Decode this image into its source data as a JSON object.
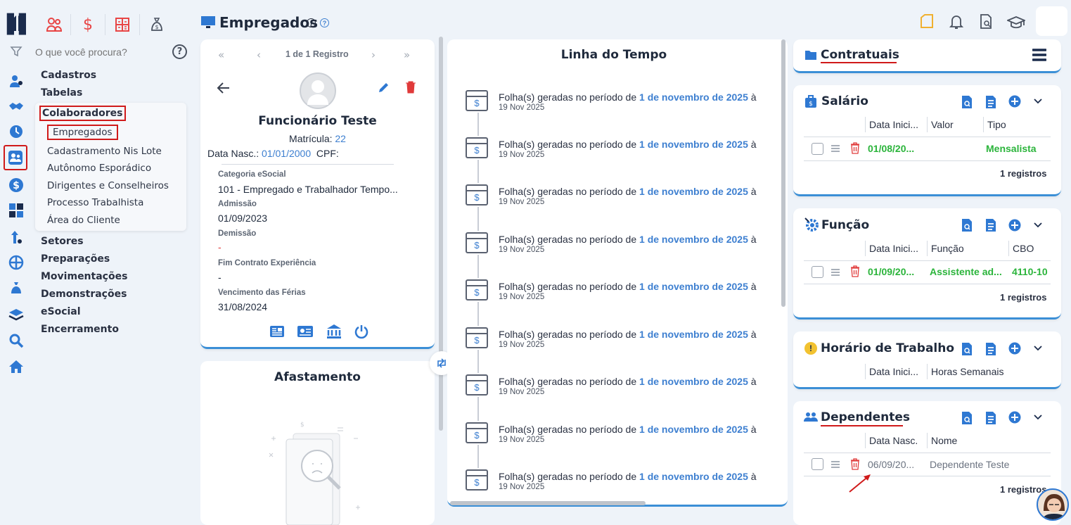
{
  "top_modules": [
    {
      "icon": "people-icon",
      "color": "#e84545"
    },
    {
      "icon": "dollar-icon",
      "color": "#e84545"
    },
    {
      "icon": "calculator-icon",
      "color": "#e84545"
    },
    {
      "icon": "money-bag-icon",
      "color": "#4a5260"
    }
  ],
  "search": {
    "placeholder": "O que você procura?"
  },
  "menu": {
    "cadastros": "Cadastros",
    "tabelas": "Tabelas",
    "colaboradores": "Colaboradores",
    "sub": [
      "Empregados",
      "Cadastramento Nis Lote",
      "Autônomo Esporádico",
      "Dirigentes e Conselheiros",
      "Processo Trabalhista",
      "Área do Cliente"
    ],
    "setores": "Setores",
    "preparacoes": "Preparações",
    "movimentacoes": "Movimentações",
    "demonstracoes": "Demonstrações",
    "esocial": "eSocial",
    "encerramento": "Encerramento"
  },
  "page": {
    "title": "Empregados"
  },
  "record": {
    "nav": "1 de 1 Registro",
    "name": "Funcionário Teste",
    "matricula_label": "Matrícula:",
    "matricula": "22",
    "nasc_label": "Data Nasc.:",
    "nasc": "01/01/2000",
    "cpf_label": "CPF:",
    "cat_label": "Categoria eSocial",
    "cat": "101 - Empregado e Trabalhador Tempo...",
    "adm_label": "Admissão",
    "adm": "01/09/2023",
    "dem_label": "Demissão",
    "dem": "-",
    "fim_label": "Fim Contrato Experiência",
    "fim": "-",
    "ferias_label": "Vencimento das Férias",
    "ferias": "31/08/2024"
  },
  "afastamento": {
    "title": "Afastamento"
  },
  "timeline": {
    "title": "Linha do Tempo",
    "prefix": "Folha(s) geradas no período de ",
    "period": "1 de novembro de 2025",
    "suffix": " à",
    "date": "19 Nov 2025"
  },
  "contratuais": {
    "title": "Contratuais"
  },
  "salario": {
    "title": "Salário",
    "cols": [
      "Data Inici...",
      "Valor",
      "Tipo"
    ],
    "row": [
      "01/08/20...",
      "",
      "Mensalista"
    ],
    "count": "1 registros"
  },
  "funcao": {
    "title": "Função",
    "cols": [
      "Data Inici...",
      "Função",
      "CBO"
    ],
    "row": [
      "01/09/20...",
      "Assistente ad...",
      "4110-10"
    ],
    "count": "1 registros"
  },
  "horario": {
    "title": "Horário de Trabalho",
    "cols": [
      "Data Inici...",
      "Horas Semanais"
    ]
  },
  "dependentes": {
    "title": "Dependentes",
    "cols": [
      "Data Nasc.",
      "Nome"
    ],
    "row": [
      "06/09/20...",
      "Dependente Teste"
    ],
    "count": "1 registros"
  },
  "colors": {
    "accent": "#3d7fd0",
    "green": "#2bb43b",
    "red": "#d01a1a"
  }
}
